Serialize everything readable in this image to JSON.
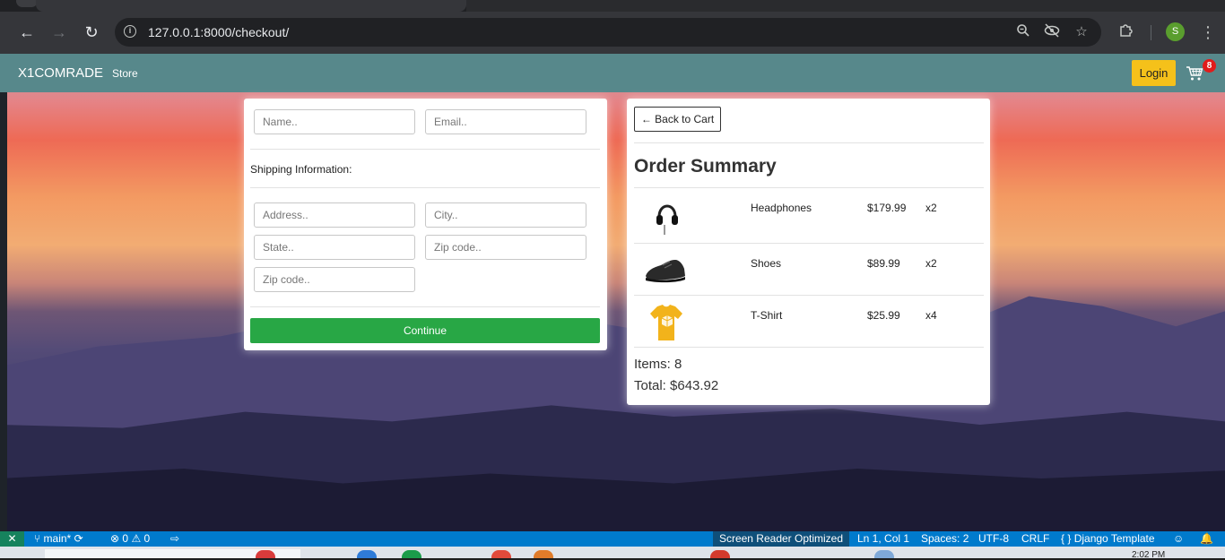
{
  "browser": {
    "url": "127.0.0.1:8000/checkout/",
    "profile_initial": "S"
  },
  "navbar": {
    "brand": "X1COMRADE",
    "store_link": "Store",
    "login_label": "Login",
    "cart_count": "8"
  },
  "form": {
    "name_placeholder": "Name..",
    "email_placeholder": "Email..",
    "shipping_label": "Shipping Information:",
    "address_placeholder": "Address..",
    "city_placeholder": "City..",
    "state_placeholder": "State..",
    "zip_placeholder": "Zip code..",
    "zip2_placeholder": "Zip code..",
    "continue_label": "Continue"
  },
  "summary": {
    "back_label": "← Back to Cart",
    "title": "Order Summary",
    "items": [
      {
        "name": "Headphones",
        "price": "$179.99",
        "qty": "x2",
        "icon": "headphones-icon"
      },
      {
        "name": "Shoes",
        "price": "$89.99",
        "qty": "x2",
        "icon": "shoe-icon"
      },
      {
        "name": "T-Shirt",
        "price": "$25.99",
        "qty": "x4",
        "icon": "tshirt-icon"
      }
    ],
    "items_line": "Items: 8",
    "total_line": "Total: $643.92"
  },
  "statusbar": {
    "branch": "main*",
    "errors": "0",
    "warnings": "0",
    "screen_reader": "Screen Reader Optimized",
    "position": "Ln 1, Col 1",
    "spaces": "Spaces: 2",
    "encoding": "UTF-8",
    "eol": "CRLF",
    "language": "Django Template"
  },
  "taskbar": {
    "clock": "2:02 PM"
  },
  "colors": {
    "navbar": "#57888b",
    "login": "#f5c11a",
    "continue": "#28a745",
    "badge": "#e21b1b",
    "statusbar": "#007acc"
  }
}
